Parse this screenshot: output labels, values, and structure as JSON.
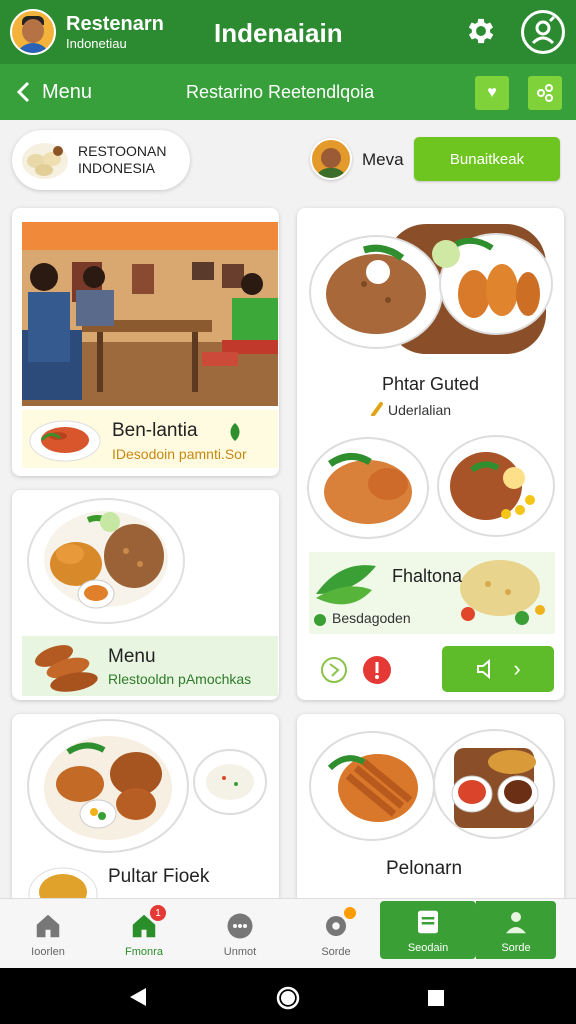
{
  "header": {
    "brand_line1": "Restenarn",
    "brand_line2": "Indonetiau",
    "title": "Indenaiain"
  },
  "subheader": {
    "back_label": "Menu",
    "title": "Restarino Reetendlqoia"
  },
  "chip": {
    "line1": "RESTOONAN",
    "line2": "INDONESIA"
  },
  "user": {
    "label": "Meva"
  },
  "cta_button": "Bunaitkeak",
  "cards": {
    "restaurant": {
      "title": "Ben-lantia",
      "subtitle": "IDesodoin pamnti.Sor",
      "icon": "leaf-icon"
    },
    "menu": {
      "title": "Menu",
      "subtitle": "Rlestooldn pAmochkas"
    },
    "right_top": {
      "title": "Phtar Guted",
      "subtitle": "Uderlalian"
    },
    "right_mid": {
      "title": "Fhaltona",
      "subtitle": "Besdagoden"
    },
    "left_bottom": {
      "title": "Pultar Fioek"
    },
    "right_bottom": {
      "title": "Pelonarn"
    }
  },
  "bottom_nav": [
    {
      "label": "Ioorlen",
      "icon": "home-icon"
    },
    {
      "label": "Fmonra",
      "icon": "home-icon",
      "badge": "1"
    },
    {
      "label": "Unmot",
      "icon": "chat-icon"
    },
    {
      "label": "Sorde",
      "icon": "gear-icon"
    },
    {
      "label": "Seodain",
      "icon": "receipt-icon"
    },
    {
      "label": "Sorde",
      "icon": "person-icon"
    }
  ],
  "colors": {
    "primary": "#2c8a30",
    "secondary": "#38a03a",
    "accent": "#6fc51f",
    "highlight": "#c78812"
  }
}
